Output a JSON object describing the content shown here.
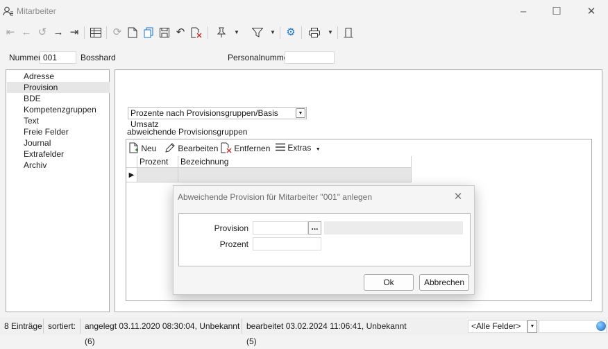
{
  "window": {
    "title": "Mitarbeiter"
  },
  "header": {
    "nummer_label": "Nummer",
    "nummer_value": "001",
    "name": "Bosshard",
    "personalnummer_label": "Personalnummer",
    "personalnummer_value": ""
  },
  "nav": {
    "items": [
      {
        "label": "Adresse"
      },
      {
        "label": "Provision"
      },
      {
        "label": "BDE"
      },
      {
        "label": "Kompetenzgruppen"
      },
      {
        "label": "Text"
      },
      {
        "label": "Freie Felder"
      },
      {
        "label": "Journal"
      },
      {
        "label": "Extrafelder"
      },
      {
        "label": "Archiv"
      }
    ]
  },
  "provision": {
    "mode_selected": "Prozente nach Provisionsgruppen/Basis Umsatz",
    "section_label": "abweichende Provisionsgruppen",
    "toolbar": {
      "new": "Neu",
      "edit": "Bearbeiten",
      "remove": "Entfernen",
      "extras": "Extras"
    },
    "columns": [
      "Prozent",
      "Bezeichnung"
    ]
  },
  "dialog": {
    "title": "Abweichende Provision für Mitarbeiter \"001\" anlegen",
    "provision_label": "Provision",
    "provision_button": "...",
    "prozent_label": "Prozent",
    "ok": "Ok",
    "cancel": "Abbrechen"
  },
  "status": {
    "count": "8 Einträge",
    "sorted": "sortiert:",
    "created": "angelegt 03.11.2020 08:30:04, Unbekannt (6)",
    "edited": "bearbeitet 03.02.2024 11:06:41, Unbekannt (5)",
    "filter_value": "<Alle Felder>"
  }
}
